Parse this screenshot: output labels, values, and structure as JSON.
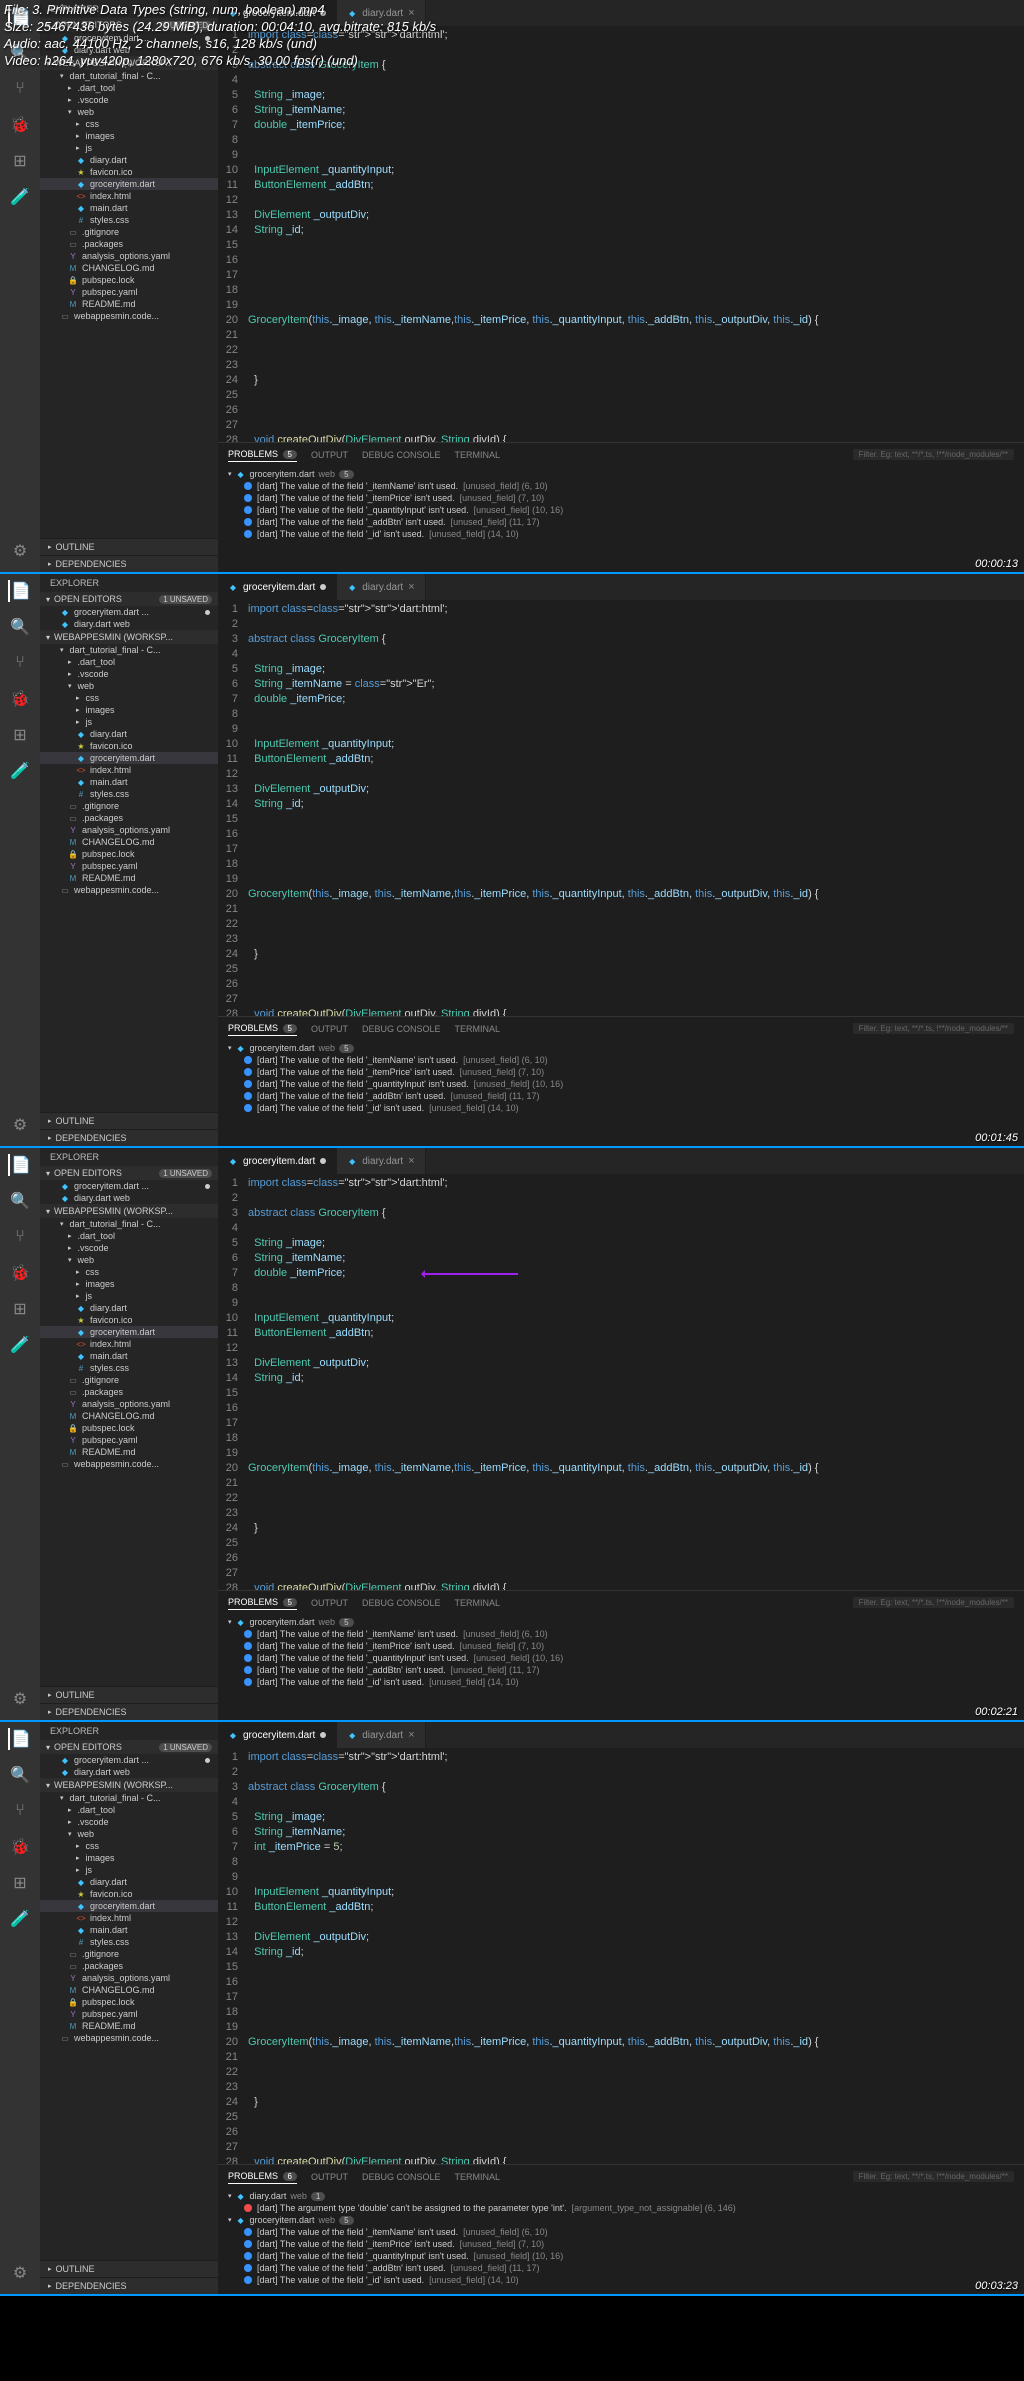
{
  "media_info": {
    "file": "File: 3. Primitive Data Types (string, num, boolean).mp4",
    "size": "Size: 25467436 bytes (24.29 MiB), duration: 00:04:10, avg.bitrate: 815 kb/s",
    "audio": "Audio: aac, 44100 Hz, 2 channels, s16, 128 kb/s (und)",
    "video": "Video: h264, yuv420p, 1280x720, 676 kb/s, 30.00 fps(r) (und)"
  },
  "timestamps": [
    "00:00:13",
    "00:01:45",
    "00:02:21",
    "00:03:23"
  ],
  "sidebar": {
    "title": "EXPLORER",
    "open_editors": {
      "label": "OPEN EDITORS",
      "unsaved": "1 UNSAVED"
    },
    "workspace_label": "WEBAPPESMIN (WORKSP...",
    "sections": {
      "outline": "OUTLINE",
      "deps": "DEPENDENCIES"
    },
    "open_files": [
      {
        "name": "groceryitem.dart ...",
        "mod": true
      },
      {
        "name": "diary.dart  web"
      }
    ],
    "tree_common": [
      {
        "name": "dart_tutorial_final - C...",
        "type": "folder",
        "open": true,
        "indent": 0
      },
      {
        "name": ".dart_tool",
        "type": "folder",
        "indent": 1
      },
      {
        "name": ".vscode",
        "type": "folder",
        "indent": 1
      },
      {
        "name": "web",
        "type": "folder",
        "open": true,
        "indent": 1
      },
      {
        "name": "css",
        "type": "folder",
        "indent": 2
      },
      {
        "name": "images",
        "type": "folder",
        "indent": 2
      },
      {
        "name": "js",
        "type": "folder",
        "indent": 2
      },
      {
        "name": "diary.dart",
        "type": "file",
        "ico": "dart",
        "indent": 2
      },
      {
        "name": "favicon.ico",
        "type": "file",
        "ico": "ico",
        "indent": 2
      },
      {
        "name": "groceryitem.dart",
        "type": "file",
        "ico": "dart",
        "indent": 2,
        "active": true
      },
      {
        "name": "index.html",
        "type": "file",
        "ico": "html",
        "indent": 2
      },
      {
        "name": "main.dart",
        "type": "file",
        "ico": "dart",
        "indent": 2
      },
      {
        "name": "styles.css",
        "type": "file",
        "ico": "css",
        "indent": 2
      },
      {
        "name": ".gitignore",
        "type": "file",
        "ico": "pkg",
        "indent": 1
      },
      {
        "name": ".packages",
        "type": "file",
        "ico": "pkg",
        "indent": 1
      },
      {
        "name": "analysis_options.yaml",
        "type": "file",
        "ico": "yaml",
        "indent": 1
      },
      {
        "name": "CHANGELOG.md",
        "type": "file",
        "ico": "md",
        "indent": 1
      },
      {
        "name": "pubspec.lock",
        "type": "file",
        "ico": "lock",
        "indent": 1
      },
      {
        "name": "pubspec.yaml",
        "type": "file",
        "ico": "yaml",
        "indent": 1
      },
      {
        "name": "README.md",
        "type": "file",
        "ico": "md",
        "indent": 1
      },
      {
        "name": "webappesmin.code...",
        "type": "file",
        "ico": "pkg",
        "indent": 0
      }
    ]
  },
  "tabs": [
    {
      "name": "groceryitem.dart",
      "mod": true,
      "active": true
    },
    {
      "name": "diary.dart"
    }
  ],
  "code_frames": {
    "f1_6": "  String _itemName;",
    "f2_6": "  String _itemName = \"Er\";",
    "f4_6": "  String _itemName;",
    "f1_7": "  double _itemPrice;",
    "f4_7": "  int _itemPrice = 5;",
    "common": {
      "1": "import 'dart:html';",
      "2": "",
      "3": "abstract class GroceryItem {",
      "4": "",
      "5": "  String _image;",
      "8": "",
      "9": "",
      "10": "  InputElement _quantityInput;",
      "11": "  ButtonElement _addBtn;",
      "12": "",
      "13": "  DivElement _outputDiv;",
      "14": "  String _id;",
      "15": "",
      "16": "",
      "17": "",
      "18": "",
      "19": "",
      "20": "GroceryItem(this._image, this._itemName,this._itemPrice, this._quantityInput, this._addBtn, this._outputDiv, this._id) {",
      "21": "",
      "22": "",
      "23": "",
      "24": "  }",
      "25": "",
      "26": "",
      "27": "",
      "28": "  void createOutDiv(DivElement outDiv, String divId) {"
    }
  },
  "panel": {
    "tabs": {
      "problems": "PROBLEMS",
      "output": "OUTPUT",
      "debug": "DEBUG CONSOLE",
      "terminal": "TERMINAL"
    },
    "badge_std": "5",
    "badge_f4": "6",
    "filter": "Filter. Eg: text, **/*.ts, !**/node_modules/**",
    "file": "groceryitem.dart",
    "file_path": "web",
    "file_cnt": "5",
    "items_std": [
      {
        "t": "info",
        "msg": "[dart] The value of the field '_itemName' isn't used.",
        "meta": "[unused_field] (6, 10)"
      },
      {
        "t": "info",
        "msg": "[dart] The value of the field '_itemPrice' isn't used.",
        "meta": "[unused_field] (7, 10)"
      },
      {
        "t": "info",
        "msg": "[dart] The value of the field '_quantityInput' isn't used.",
        "meta": "[unused_field] (10, 16)"
      },
      {
        "t": "info",
        "msg": "[dart] The value of the field '_addBtn' isn't used.",
        "meta": "[unused_field] (11, 17)"
      },
      {
        "t": "info",
        "msg": "[dart] The value of the field '_id' isn't used.",
        "meta": "[unused_field] (14, 10)"
      }
    ],
    "diary_file": "diary.dart",
    "diary_cnt": "1",
    "items_f4_err": {
      "t": "err",
      "msg": "[dart] The argument type 'double' can't be assigned to the parameter type 'int'.",
      "meta": "[argument_type_not_assignable] (6, 146)"
    }
  }
}
